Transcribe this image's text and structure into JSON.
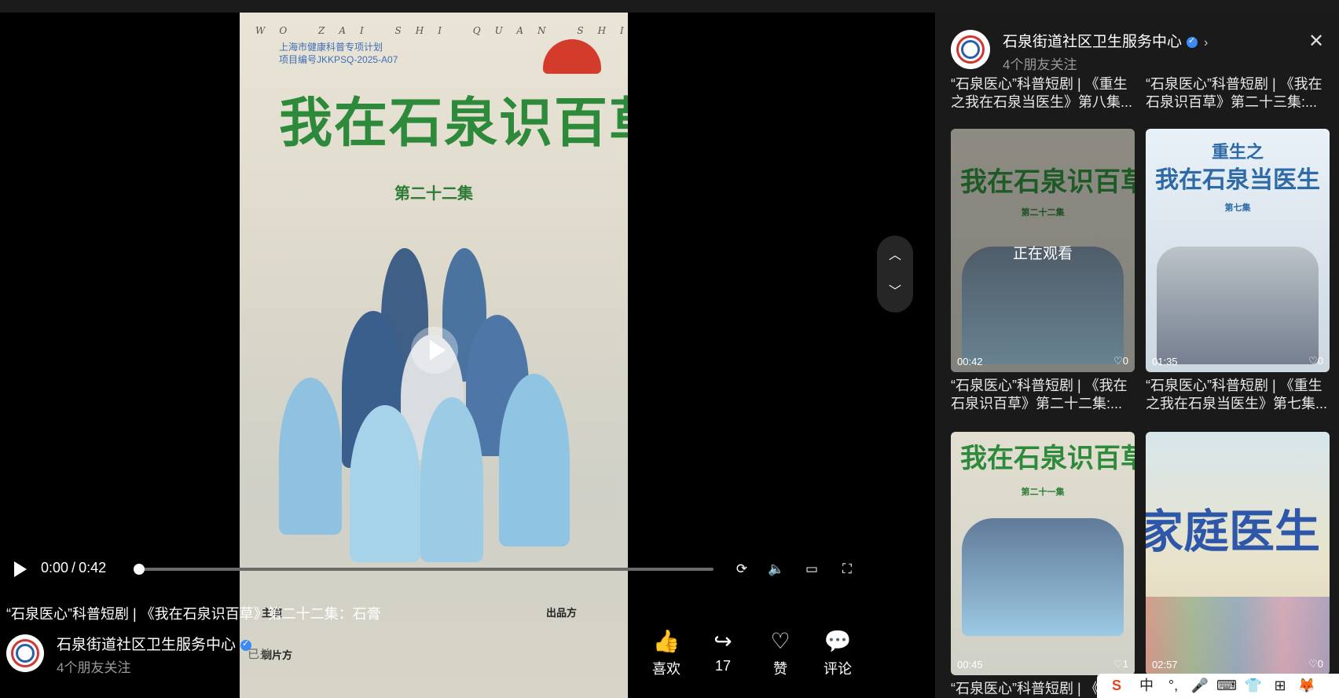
{
  "video": {
    "poster_pinyin": "WO ZAI SHI QUAN SHI BAI CAO",
    "poster_project_line1": "上海市健康科普专项计划",
    "poster_project_line2": "项目编号JKKPSQ-2025-A07",
    "poster_title": "我在石泉识百草",
    "poster_episode": "第二十二集",
    "credits_left_head": "主演",
    "credits_right_head": "出品方",
    "credits_bottom_head": "制片方"
  },
  "controls": {
    "current_time": "0:00",
    "separator": "/",
    "duration": "0:42",
    "progress_fraction": 0.0
  },
  "info": {
    "title": "“石泉医心”科普短剧 | 《我在石泉识百草》第二十二集：石膏",
    "author": "石泉街道社区卫生服务中心",
    "friends": "4个朋友关注",
    "followed_hint": "已关"
  },
  "actions": [
    {
      "label": "喜欢",
      "icon": "thumb-up-icon"
    },
    {
      "label": "17",
      "icon": "share-icon"
    },
    {
      "label": "赞",
      "icon": "heart-icon"
    },
    {
      "label": "评论",
      "icon": "comment-icon"
    }
  ],
  "sidebar": {
    "author": "石泉街道社区卫生服务中心",
    "friends": "4个朋友关注",
    "top_captions": [
      "“石泉医心”科普短剧 | 《重生之我在石泉当医生》第八集...",
      "“石泉医心”科普短剧 | 《我在石泉识百草》第二十三集:..."
    ],
    "videos": [
      {
        "duration": "00:42",
        "likes": "0",
        "caption": "“石泉医心”科普短剧 | 《我在石泉识百草》第二十二集:...",
        "watching": "正在观看",
        "thumb_title": "我在石泉识百草",
        "thumb_ep": "第二十二集"
      },
      {
        "duration": "01:35",
        "likes": "0",
        "caption": "“石泉医心”科普短剧 | 《重生之我在石泉当医生》第七集...",
        "thumb_title_1": "重生之",
        "thumb_title_2": "我在石泉当医生",
        "thumb_ep": "第七集"
      },
      {
        "duration": "00:45",
        "likes": "1",
        "caption": "“石泉医心”科普短剧 | 《",
        "thumb_title": "我在石泉识百草",
        "thumb_ep": "第二十一集"
      },
      {
        "duration": "02:57",
        "likes": "0",
        "thumb_title": "家庭医生"
      }
    ]
  },
  "ime": {
    "items": [
      "S",
      "中",
      "°,",
      "🎤",
      "⌨",
      "👕",
      "⊞",
      "🦊"
    ]
  },
  "colors": {
    "poster_green": "#2d8a3a",
    "verified_blue": "#3d8cf6",
    "sidebar_bg": "#1a1a1a"
  }
}
